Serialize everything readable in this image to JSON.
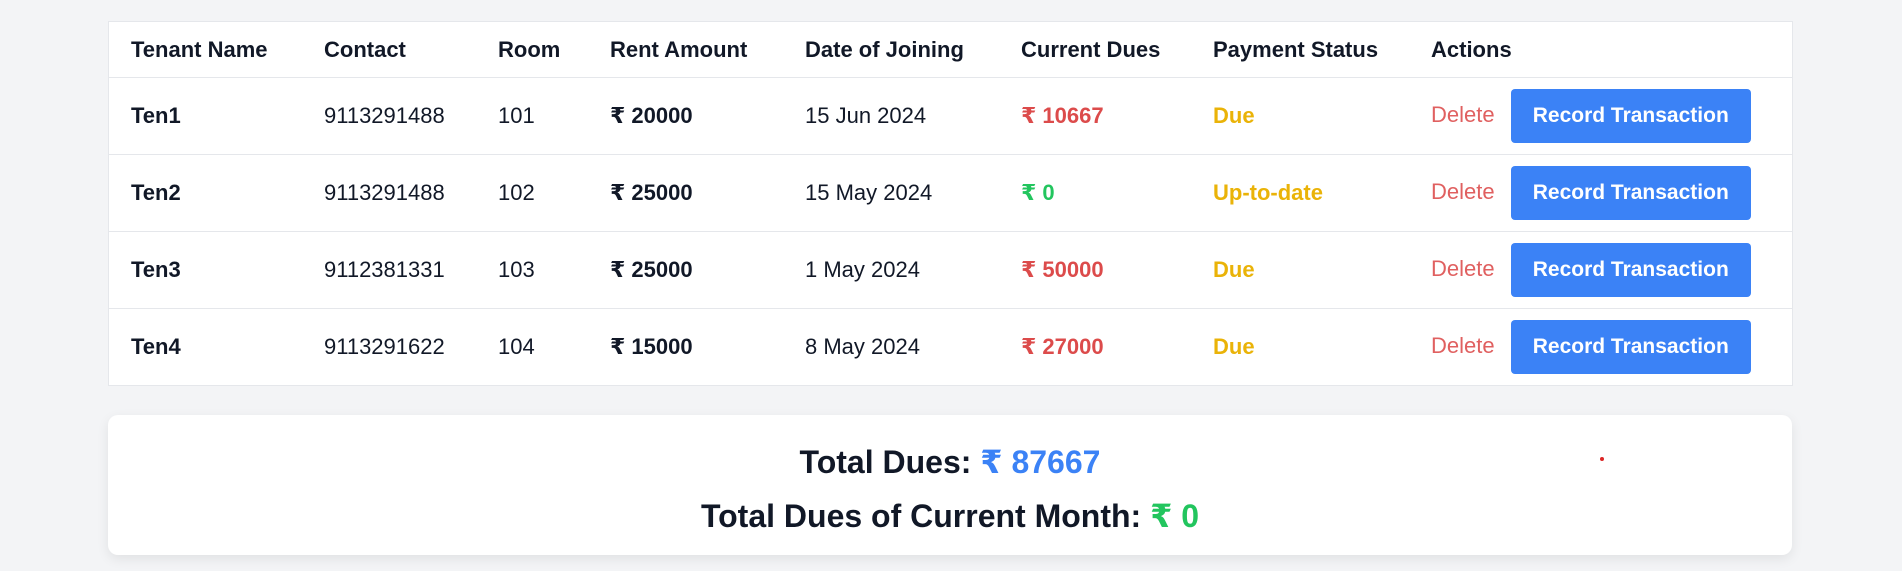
{
  "table": {
    "headers": [
      "Tenant Name",
      "Contact",
      "Room",
      "Rent Amount",
      "Date of Joining",
      "Current Dues",
      "Payment Status",
      "Actions"
    ],
    "rows": [
      {
        "name": "Ten1",
        "contact": "9113291488",
        "room": "101",
        "rent": "₹ 20000",
        "joined": "15 Jun 2024",
        "dues": "₹ 10667",
        "status": "Due",
        "delete": "Delete",
        "record": "Record Transaction"
      },
      {
        "name": "Ten2",
        "contact": "9113291488",
        "room": "102",
        "rent": "₹ 25000",
        "joined": "15 May 2024",
        "dues": "₹ 0",
        "status": "Up-to-date",
        "delete": "Delete",
        "record": "Record Transaction"
      },
      {
        "name": "Ten3",
        "contact": "9112381331",
        "room": "103",
        "rent": "₹ 25000",
        "joined": "1 May 2024",
        "dues": "₹ 50000",
        "status": "Due",
        "delete": "Delete",
        "record": "Record Transaction"
      },
      {
        "name": "Ten4",
        "contact": "9113291622",
        "room": "104",
        "rent": "₹ 15000",
        "joined": "8 May 2024",
        "dues": "₹ 27000",
        "status": "Due",
        "delete": "Delete",
        "record": "Record Transaction"
      }
    ]
  },
  "summary": {
    "total_dues_label": "Total Dues:",
    "total_dues_value": "₹ 87667",
    "current_month_label": "Total Dues of Current Month:",
    "current_month_value": "₹ 0"
  },
  "colors": {
    "primary": "#3b82f6",
    "due_red": "#dc4b4b",
    "paid_green": "#22c55e",
    "status_yellow": "#eab308",
    "delete_red": "#e06060"
  }
}
